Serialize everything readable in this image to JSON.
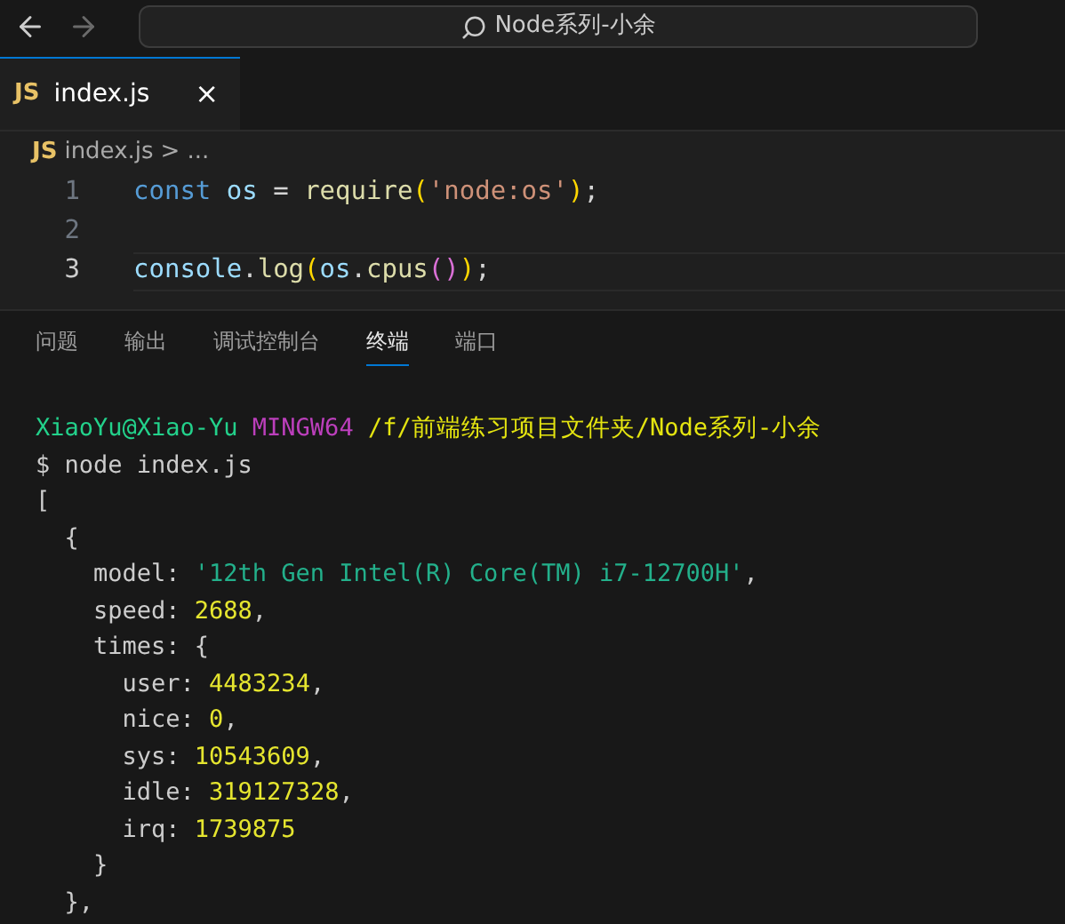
{
  "title_bar": {
    "search": "Node系列-小余"
  },
  "tabs": [
    {
      "label": "index.js",
      "icon": "JS",
      "selected": true,
      "close": "×"
    }
  ],
  "breadcrumb": {
    "icon": "JS",
    "file": "index.js",
    "separator": ">",
    "rest": "..."
  },
  "editor": {
    "lines": [
      {
        "number": "1",
        "current": false,
        "tokens": [
          {
            "text": "const ",
            "kind": "keyword"
          },
          {
            "text": "os",
            "kind": "variable"
          },
          {
            "text": " = ",
            "kind": "plain"
          },
          {
            "text": "require",
            "kind": "function"
          },
          {
            "text": "(",
            "kind": "bracket"
          },
          {
            "text": "'node:os'",
            "kind": "string"
          },
          {
            "text": ")",
            "kind": "bracket"
          },
          {
            "text": ";",
            "kind": "plain"
          }
        ]
      },
      {
        "number": "2",
        "current": false
      },
      {
        "number": "3",
        "current": true,
        "tokens": [
          {
            "text": "console",
            "kind": "variable"
          },
          {
            "text": ".",
            "kind": "plain"
          },
          {
            "text": "log",
            "kind": "function"
          },
          {
            "text": "(",
            "kind": "bracket"
          },
          {
            "text": "os",
            "kind": "variable"
          },
          {
            "text": ".",
            "kind": "plain"
          },
          {
            "text": "cpus",
            "kind": "function"
          },
          {
            "text": "()",
            "kind": "bracket2"
          },
          {
            "text": ")",
            "kind": "bracket"
          },
          {
            "text": ";",
            "kind": "plain"
          }
        ]
      }
    ]
  },
  "panel_tabs": [
    {
      "label": "问题",
      "selected": false
    },
    {
      "label": "输出",
      "selected": false
    },
    {
      "label": "调试控制台",
      "selected": false
    },
    {
      "label": "终端",
      "selected": true
    },
    {
      "label": "端口",
      "selected": false
    }
  ],
  "terminal": {
    "lines": [
      [
        {
          "text": "XiaoYu@Xiao-Yu ",
          "kind": "user"
        },
        {
          "text": "MINGW64 ",
          "kind": "host"
        },
        {
          "text": "/f/前端练习项目文件夹/Node系列-小余",
          "kind": "path"
        }
      ],
      [
        {
          "text": "$ node index.js",
          "kind": "plain"
        }
      ],
      [
        {
          "text": "[",
          "kind": "plain"
        }
      ],
      [
        {
          "text": "  {",
          "kind": "plain"
        }
      ],
      [
        {
          "text": "    model: ",
          "kind": "plain"
        },
        {
          "text": "'12th Gen Intel(R) Core(TM) i7-12700H'",
          "kind": "string"
        },
        {
          "text": ",",
          "kind": "plain"
        }
      ],
      [
        {
          "text": "    speed: ",
          "kind": "plain"
        },
        {
          "text": "2688",
          "kind": "number"
        },
        {
          "text": ",",
          "kind": "plain"
        }
      ],
      [
        {
          "text": "    times: {",
          "kind": "plain"
        }
      ],
      [
        {
          "text": "      user: ",
          "kind": "plain"
        },
        {
          "text": "4483234",
          "kind": "number"
        },
        {
          "text": ",",
          "kind": "plain"
        }
      ],
      [
        {
          "text": "      nice: ",
          "kind": "plain"
        },
        {
          "text": "0",
          "kind": "number"
        },
        {
          "text": ",",
          "kind": "plain"
        }
      ],
      [
        {
          "text": "      sys: ",
          "kind": "plain"
        },
        {
          "text": "10543609",
          "kind": "number"
        },
        {
          "text": ",",
          "kind": "plain"
        }
      ],
      [
        {
          "text": "      idle: ",
          "kind": "plain"
        },
        {
          "text": "319127328",
          "kind": "number"
        },
        {
          "text": ",",
          "kind": "plain"
        }
      ],
      [
        {
          "text": "      irq: ",
          "kind": "plain"
        },
        {
          "text": "1739875",
          "kind": "number"
        }
      ],
      [
        {
          "text": "    }",
          "kind": "plain"
        }
      ],
      [
        {
          "text": "  },",
          "kind": "plain"
        }
      ]
    ]
  }
}
